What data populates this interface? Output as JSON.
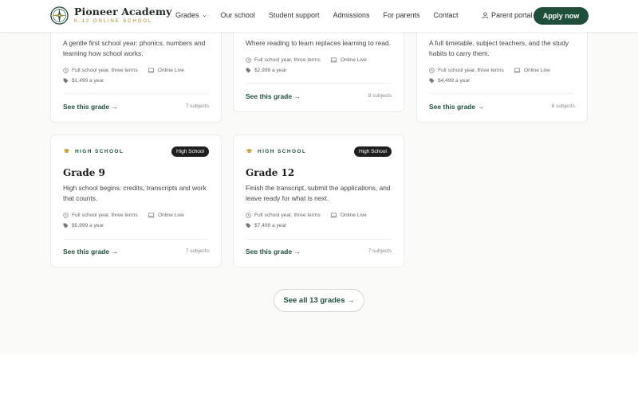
{
  "brand": {
    "name": "Pioneer Academy",
    "tagline": "K-12 ONLINE SCHOOL",
    "accent": "#1f4e3a",
    "gold": "#b08a2a"
  },
  "nav": {
    "items": [
      {
        "label": "Grades",
        "has_dropdown": true
      },
      {
        "label": "Our school"
      },
      {
        "label": "Student support"
      },
      {
        "label": "Admissions"
      },
      {
        "label": "For parents"
      },
      {
        "label": "Contact"
      }
    ],
    "portal_label": "Parent portal",
    "apply_label": "Apply now"
  },
  "cards_top": [
    {
      "description": "A gentle first school year: phonics, numbers and learning how school works.",
      "schedule": "Full school year, three terms",
      "format": "Online Live",
      "price": "$1,499 a year",
      "cta": "See this grade →",
      "subjects": "7 subjects"
    },
    {
      "description": "Where reading to learn replaces learning to read.",
      "schedule": "Full school year, three terms",
      "format": "Online Live",
      "price": "$2,999 a year",
      "cta": "See this grade →",
      "subjects": "8 subjects"
    },
    {
      "description": "A full timetable, subject teachers, and the study habits to carry them.",
      "schedule": "Full school year, three terms",
      "format": "Online Live",
      "price": "$4,499 a year",
      "cta": "See this grade →",
      "subjects": "8 subjects"
    }
  ],
  "cards_bottom": [
    {
      "level": "HIGH SCHOOL",
      "badge": "High School",
      "title": "Grade 9",
      "description": "High school begins: credits, transcripts and work that counts.",
      "schedule": "Full school year, three terms",
      "format": "Online Live",
      "price": "$5,999 a year",
      "cta": "See this grade →",
      "subjects": "7 subjects"
    },
    {
      "level": "HIGH SCHOOL",
      "badge": "High School",
      "title": "Grade 12",
      "description": "Finish the transcript, submit the applications, and leave ready for what is next.",
      "schedule": "Full school year, three terms",
      "format": "Online Live",
      "price": "$7,499 a year",
      "cta": "See this grade →",
      "subjects": "7 subjects"
    }
  ],
  "see_all_label": "See all 13 grades →"
}
